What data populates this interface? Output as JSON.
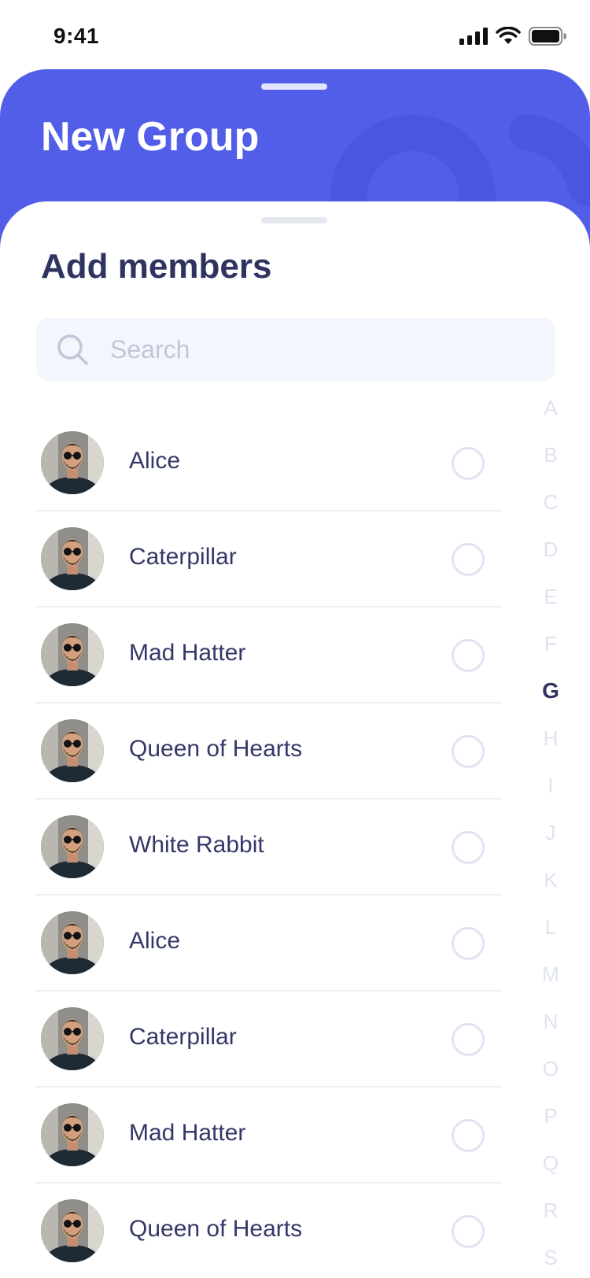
{
  "status_bar": {
    "time": "9:41"
  },
  "header": {
    "title": "New Group"
  },
  "sheet": {
    "title": "Add members"
  },
  "search": {
    "placeholder": "Search",
    "value": ""
  },
  "members": [
    {
      "name": "Alice",
      "selected": false
    },
    {
      "name": "Caterpillar",
      "selected": false
    },
    {
      "name": "Mad Hatter",
      "selected": false
    },
    {
      "name": "Queen of Hearts",
      "selected": false
    },
    {
      "name": "White Rabbit",
      "selected": false
    },
    {
      "name": "Alice",
      "selected": false
    },
    {
      "name": "Caterpillar",
      "selected": false
    },
    {
      "name": "Mad Hatter",
      "selected": false
    },
    {
      "name": "Queen of Hearts",
      "selected": false
    }
  ],
  "alphabet_index": {
    "letters": [
      "A",
      "B",
      "C",
      "D",
      "E",
      "F",
      "G",
      "H",
      "I",
      "J",
      "K",
      "L",
      "M",
      "N",
      "O",
      "P",
      "Q",
      "R",
      "S"
    ],
    "active": "G"
  },
  "colors": {
    "accent": "#525de8",
    "text_primary": "#343868",
    "circle_border": "#e1e5f3",
    "index_inactive": "#dfe3f0"
  },
  "icons": {
    "status": [
      "cellular-signal-icon",
      "wifi-icon",
      "battery-icon"
    ],
    "search": "search-icon",
    "row_select": "radio-circle-icon",
    "avatar": "avatar"
  }
}
